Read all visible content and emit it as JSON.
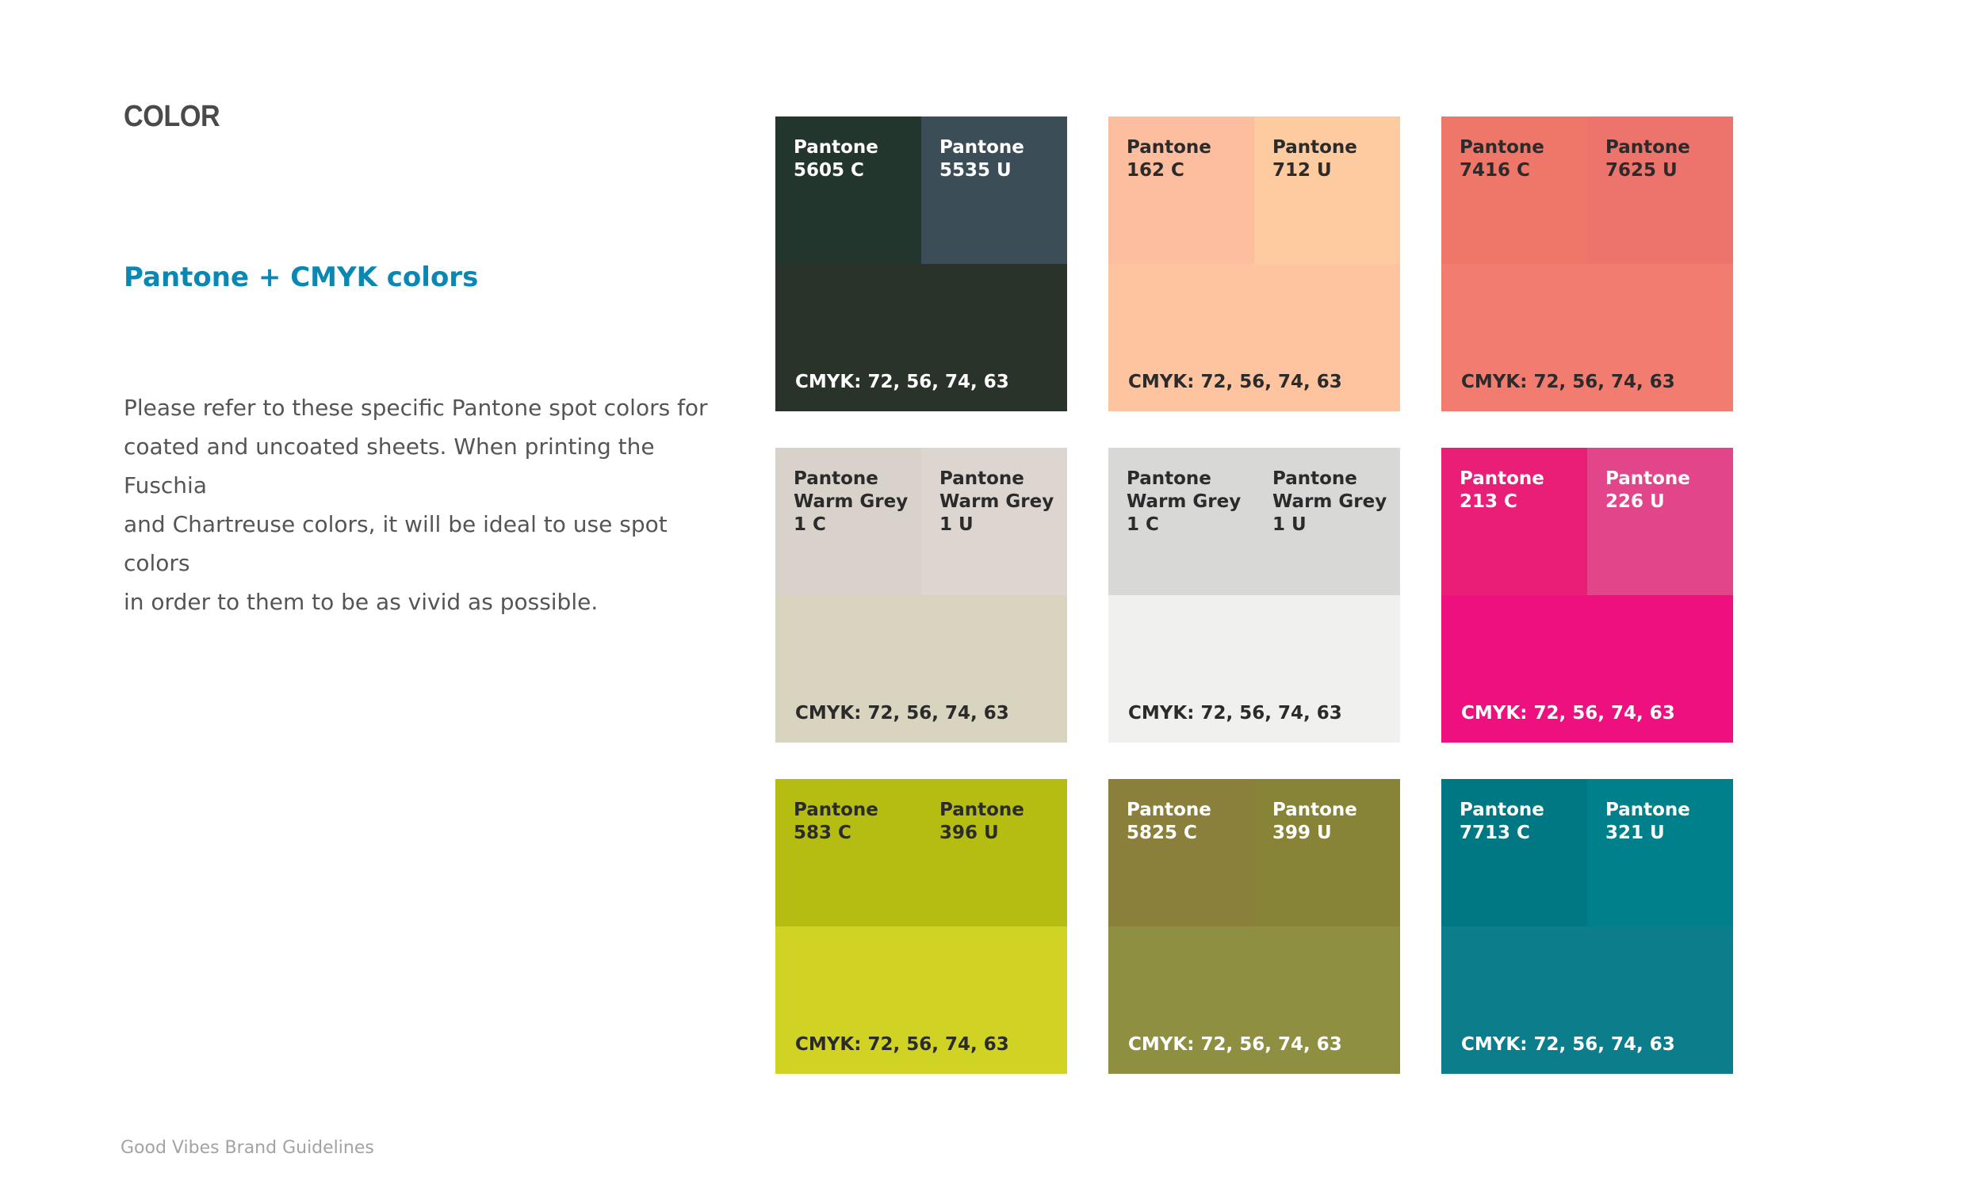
{
  "section_label": "COLOR",
  "heading": "Pantone + CMYK colors",
  "body_lines": [
    "Please refer to these specific Pantone spot colors for",
    "coated and uncoated sheets. When printing the Fuschia",
    "and Chartreuse colors, it will be ideal to use spot colors",
    "in order to them to be as vivid as possible."
  ],
  "footer": "Good Vibes Brand Guidelines",
  "swatches": [
    {
      "coated": {
        "lines": [
          "Pantone",
          "5605 C"
        ],
        "color": "#22362d"
      },
      "uncoated": {
        "lines": [
          "Pantone",
          "5535 U"
        ],
        "color": "#3b4d57"
      },
      "cmyk": {
        "label": "CMYK: 72, 56, 74, 63",
        "color": "#29332a"
      },
      "text_color": "#ffffff"
    },
    {
      "coated": {
        "lines": [
          "Pantone",
          "162 C"
        ],
        "color": "#fdbea0"
      },
      "uncoated": {
        "lines": [
          "Pantone",
          "712 U"
        ],
        "color": "#fdcb9f"
      },
      "cmyk": {
        "label": "CMYK: 72, 56, 74, 63",
        "color": "#fdc49f"
      },
      "text_color": "#2b2b2b"
    },
    {
      "coated": {
        "lines": [
          "Pantone",
          "7416 C"
        ],
        "color": "#ef7769"
      },
      "uncoated": {
        "lines": [
          "Pantone",
          "7625 U"
        ],
        "color": "#ed746c"
      },
      "cmyk": {
        "label": "CMYK: 72, 56, 74, 63",
        "color": "#f27c70"
      },
      "text_color": "#2b2b2b"
    },
    {
      "coated": {
        "lines": [
          "Pantone",
          "Warm Grey",
          "1 C"
        ],
        "color": "#d9d2cb"
      },
      "uncoated": {
        "lines": [
          "Pantone",
          "Warm Grey",
          "1 U"
        ],
        "color": "#ddd5d0"
      },
      "cmyk": {
        "label": "CMYK: 72, 56, 74, 63",
        "color": "#d9d4bf"
      },
      "text_color": "#2b2b2b"
    },
    {
      "coated": {
        "lines": [
          "Pantone",
          "Warm Grey",
          "1 C"
        ],
        "color": "#d8d8d7"
      },
      "uncoated": {
        "lines": [
          "Pantone",
          "Warm Grey",
          "1 U"
        ],
        "color": "#d8d8d7"
      },
      "cmyk": {
        "label": "CMYK: 72, 56, 74, 63",
        "color": "#f0f0ee"
      },
      "text_color": "#2b2b2b"
    },
    {
      "coated": {
        "lines": [
          "Pantone",
          "213 C"
        ],
        "color": "#e91e77"
      },
      "uncoated": {
        "lines": [
          "Pantone",
          "226 U"
        ],
        "color": "#e2458a"
      },
      "cmyk": {
        "label": "CMYK: 72, 56, 74, 63",
        "color": "#ee107f"
      },
      "text_color": "#ffffff"
    },
    {
      "coated": {
        "lines": [
          "Pantone",
          "583 C"
        ],
        "color": "#b5bd12"
      },
      "uncoated": {
        "lines": [
          "Pantone",
          "396 U"
        ],
        "color": "#b5bd12"
      },
      "cmyk": {
        "label": "CMYK: 72, 56, 74, 63",
        "color": "#d1d324"
      },
      "text_color": "#2b2b2b"
    },
    {
      "coated": {
        "lines": [
          "Pantone",
          "5825 C"
        ],
        "color": "#8a7f3b"
      },
      "uncoated": {
        "lines": [
          "Pantone",
          "399 U"
        ],
        "color": "#878337"
      },
      "cmyk": {
        "label": "CMYK: 72, 56, 74, 63",
        "color": "#8f8f42"
      },
      "text_color": "#ffffff"
    },
    {
      "coated": {
        "lines": [
          "Pantone",
          "7713 C"
        ],
        "color": "#007883"
      },
      "uncoated": {
        "lines": [
          "Pantone",
          "321 U"
        ],
        "color": "#00808a"
      },
      "cmyk": {
        "label": "CMYK: 72, 56, 74, 63",
        "color": "#0c7d8a"
      },
      "text_color": "#ffffff"
    }
  ]
}
